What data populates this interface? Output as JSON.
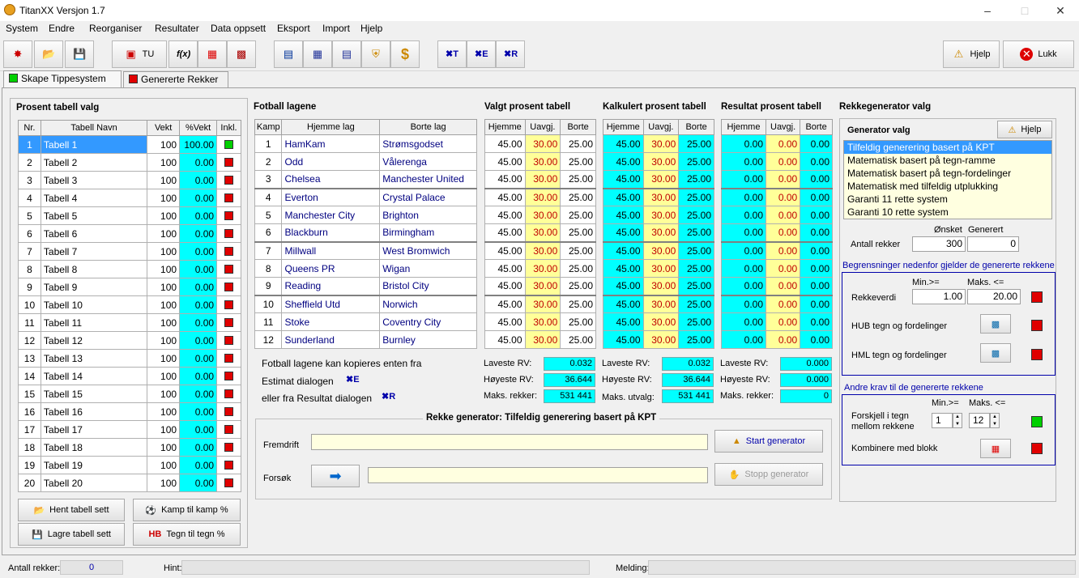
{
  "window": {
    "title": "TitanXX Versjon 1.7"
  },
  "menu": [
    "System",
    "Endre",
    "Reorganiser",
    "Resultater",
    "Data oppsett",
    "Eksport",
    "Import",
    "Hjelp"
  ],
  "toolbar": {
    "tu_label": "TU",
    "help_label": "Hjelp",
    "close_label": "Lukk"
  },
  "tabs": [
    {
      "label": "Skape Tippesystem"
    },
    {
      "label": "Genererte Rekker"
    }
  ],
  "prosent": {
    "title": "Prosent tabell valg",
    "headers": [
      "Nr.",
      "Tabell Navn",
      "Vekt",
      "%Vekt",
      "Inkl."
    ],
    "rows": [
      [
        "1",
        "Tabell 1",
        "100",
        "100.00"
      ],
      [
        "2",
        "Tabell 2",
        "100",
        "0.00"
      ],
      [
        "3",
        "Tabell 3",
        "100",
        "0.00"
      ],
      [
        "4",
        "Tabell 4",
        "100",
        "0.00"
      ],
      [
        "5",
        "Tabell 5",
        "100",
        "0.00"
      ],
      [
        "6",
        "Tabell 6",
        "100",
        "0.00"
      ],
      [
        "7",
        "Tabell 7",
        "100",
        "0.00"
      ],
      [
        "8",
        "Tabell 8",
        "100",
        "0.00"
      ],
      [
        "9",
        "Tabell 9",
        "100",
        "0.00"
      ],
      [
        "10",
        "Tabell 10",
        "100",
        "0.00"
      ],
      [
        "11",
        "Tabell 11",
        "100",
        "0.00"
      ],
      [
        "12",
        "Tabell 12",
        "100",
        "0.00"
      ],
      [
        "13",
        "Tabell 13",
        "100",
        "0.00"
      ],
      [
        "14",
        "Tabell 14",
        "100",
        "0.00"
      ],
      [
        "15",
        "Tabell 15",
        "100",
        "0.00"
      ],
      [
        "16",
        "Tabell 16",
        "100",
        "0.00"
      ],
      [
        "17",
        "Tabell 17",
        "100",
        "0.00"
      ],
      [
        "18",
        "Tabell 18",
        "100",
        "0.00"
      ],
      [
        "19",
        "Tabell 19",
        "100",
        "0.00"
      ],
      [
        "20",
        "Tabell 20",
        "100",
        "0.00"
      ]
    ],
    "buttons": {
      "hent": "Hent tabell sett",
      "kamp": "Kamp til kamp %",
      "lagre": "Lagre tabell sett",
      "tegn": "Tegn til tegn %"
    }
  },
  "fotball": {
    "title": "Fotball lagene",
    "headers": [
      "Kamp",
      "Hjemme lag",
      "Borte lag"
    ],
    "rows": [
      [
        "1",
        "HamKam",
        "Strømsgodset"
      ],
      [
        "2",
        "Odd",
        "Vålerenga"
      ],
      [
        "3",
        "Chelsea",
        "Manchester United"
      ],
      [
        "4",
        "Everton",
        "Crystal Palace"
      ],
      [
        "5",
        "Manchester City",
        "Brighton"
      ],
      [
        "6",
        "Blackburn",
        "Birmingham"
      ],
      [
        "7",
        "Millwall",
        "West Bromwich"
      ],
      [
        "8",
        "Queens PR",
        "Wigan"
      ],
      [
        "9",
        "Reading",
        "Bristol City"
      ],
      [
        "10",
        "Sheffield Utd",
        "Norwich"
      ],
      [
        "11",
        "Stoke",
        "Coventry City"
      ],
      [
        "12",
        "Sunderland",
        "Burnley"
      ]
    ],
    "note1": "Fotball lagene kan kopieres enten fra",
    "note2": "Estimat dialogen",
    "note3": "eller fra Resultat dialogen"
  },
  "pct_headers": [
    "Hjemme",
    "Uavgj.",
    "Borte"
  ],
  "valgt": {
    "title": "Valgt prosent tabell",
    "row": [
      "45.00",
      "30.00",
      "25.00"
    ],
    "labels": [
      "Laveste RV:",
      "Høyeste RV:",
      "Maks. rekker:"
    ],
    "values": [
      "0.032",
      "36.644",
      "531 441"
    ]
  },
  "kalk": {
    "title": "Kalkulert prosent tabell",
    "row": [
      "45.00",
      "30.00",
      "25.00"
    ],
    "labels": [
      "Laveste RV:",
      "Høyeste RV:",
      "Maks. utvalg:"
    ],
    "values": [
      "0.032",
      "36.644",
      "531 441"
    ]
  },
  "resultat": {
    "title": "Resultat prosent tabell",
    "row": [
      "0.00",
      "0.00",
      "0.00"
    ],
    "labels": [
      "Laveste RV:",
      "Høyeste RV:",
      "Maks. rekker:"
    ],
    "values": [
      "0.000",
      "0.000",
      "0"
    ]
  },
  "generator": {
    "legend": "Rekke generator: Tilfeldig generering basert på KPT",
    "fremdrift": "Fremdrift",
    "forsok": "Forsøk",
    "start": "Start generator",
    "stopp": "Stopp generator"
  },
  "rekkegen": {
    "title": "Rekkegenerator valg",
    "gen_valg": "Generator valg",
    "help": "Hjelp",
    "options": [
      "Tilfeldig generering basert på KPT",
      "Matematisk basert på tegn-ramme",
      "Matematisk basert på tegn-fordelinger",
      "Matematisk med tilfeldig utplukking",
      "Garanti 11 rette system",
      "Garanti 10 rette system"
    ],
    "onsket": "Ønsket",
    "generert": "Generert",
    "antall_rekker": "Antall rekker",
    "onsket_val": "300",
    "generert_val": "0",
    "begr_title": "Begrensninger nedenfor gjelder de genererte rekkene",
    "min": "Min.>=",
    "maks": "Maks. <=",
    "rekkeverdi": "Rekkeverdi",
    "rv_min": "1.00",
    "rv_max": "20.00",
    "hub": "HUB tegn og fordelinger",
    "hml": "HML tegn og fordelinger",
    "andre_title": "Andre krav til de genererte rekkene",
    "forskjell1": "Forskjell i tegn",
    "forskjell2": "mellom rekkene",
    "f_min": "1",
    "f_max": "12",
    "kombinere": "Kombinere med blokk"
  },
  "status": {
    "antall_label": "Antall rekker:",
    "antall_val": "0",
    "hint_label": "Hint:",
    "melding_label": "Melding:"
  }
}
